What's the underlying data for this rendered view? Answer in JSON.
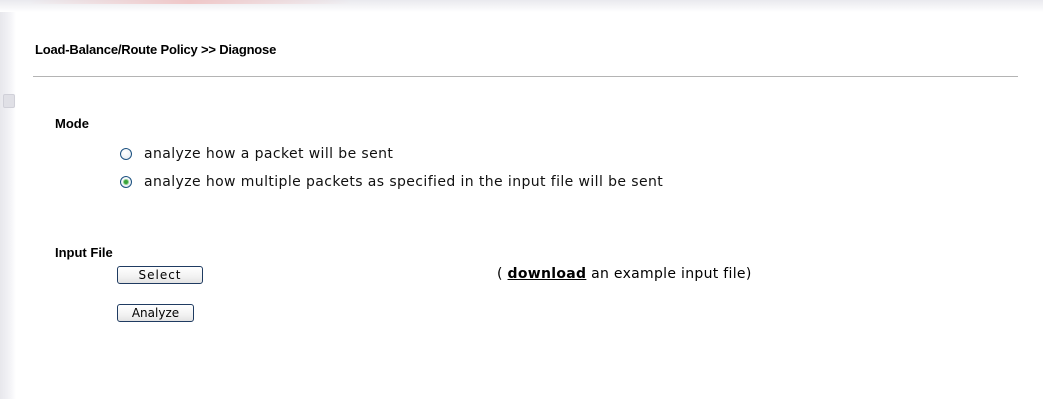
{
  "page": {
    "title": "Load-Balance/Route Policy >> Diagnose"
  },
  "mode": {
    "label": "Mode",
    "options": [
      {
        "label": "analyze how a packet will be sent",
        "checked": false
      },
      {
        "label": "analyze how multiple packets as specified in the input file will be sent",
        "checked": true
      }
    ]
  },
  "input_file": {
    "label": "Input File",
    "select_label": "Select",
    "analyze_label": "Analyze",
    "note_prefix": "(",
    "download_link": "download",
    "note_suffix": "an example input file)"
  }
}
